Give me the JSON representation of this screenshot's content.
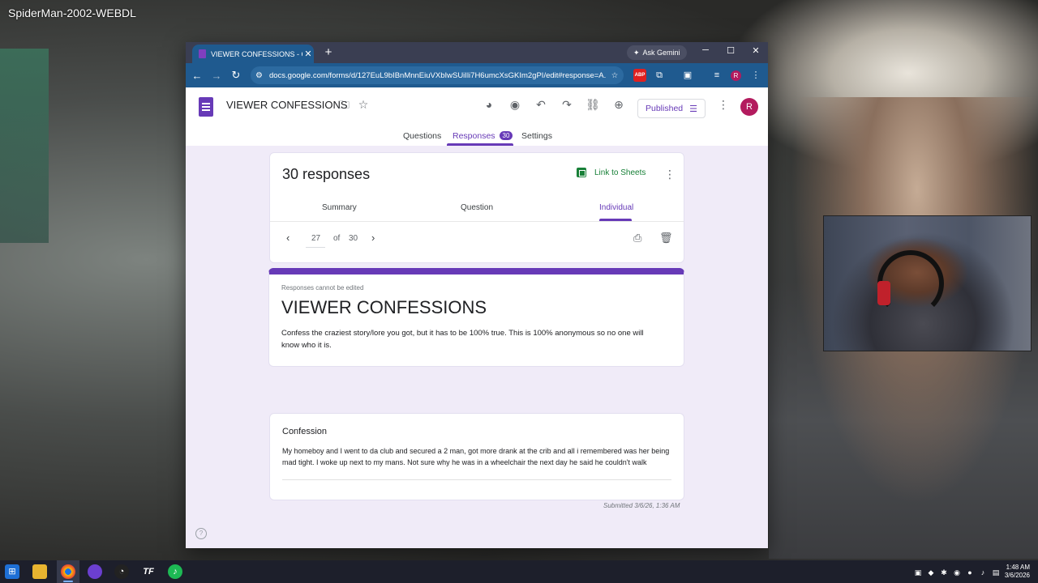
{
  "video": {
    "title": "SpiderMan-2002-WEBDL"
  },
  "browser": {
    "tab_title": "VIEWER CONFESSIONS - Googl",
    "tab_close": "✕",
    "new_tab": "+",
    "ask_gemini": "Ask Gemini",
    "url": "docs.google.com/forms/d/127EuL9bIBnMnnEiuVXbIwSUiIli7H6umcXsGKIm2gPI/edit#response=A...",
    "controls": {
      "minimize": "─",
      "maximize": "☐",
      "close": "✕"
    },
    "profile_initial": "R"
  },
  "form_header": {
    "title": "VIEWER CONFESSIONS",
    "published_label": "Published",
    "user_initial": "R",
    "tabs": [
      {
        "label": "Questions"
      },
      {
        "label": "Responses",
        "badge": "30"
      },
      {
        "label": "Settings"
      }
    ]
  },
  "responses": {
    "count_title": "30 responses",
    "link_to_sheets": "Link to Sheets",
    "subtabs": [
      "Summary",
      "Question",
      "Individual"
    ],
    "pager": {
      "current": "27",
      "of_label": "of",
      "total": "30"
    }
  },
  "form_info": {
    "notice": "Responses cannot be edited",
    "title": "VIEWER CONFESSIONS",
    "description": "Confess the craziest story/lore you got, but it has to be 100% true. This is 100% anonymous so no one will know who it is."
  },
  "question": {
    "label": "Confession",
    "answer": "My homeboy and I went to da club and secured a 2 man, got more drank at the crib and all i remembered was her being mad tight. I woke up next to my mans. Not sure why he was in a wheelchair the next day he said he couldn't walk"
  },
  "submitted": "Submitted 3/6/26, 1:36 AM",
  "help_glyph": "?",
  "taskbar": {
    "time": "1:48 AM",
    "date": "3/6/2026"
  },
  "colors": {
    "forms_purple": "#673ab7",
    "sheets_green": "#188038",
    "browser_blue": "#1f5a8f",
    "content_bg": "#f0ebf8"
  }
}
